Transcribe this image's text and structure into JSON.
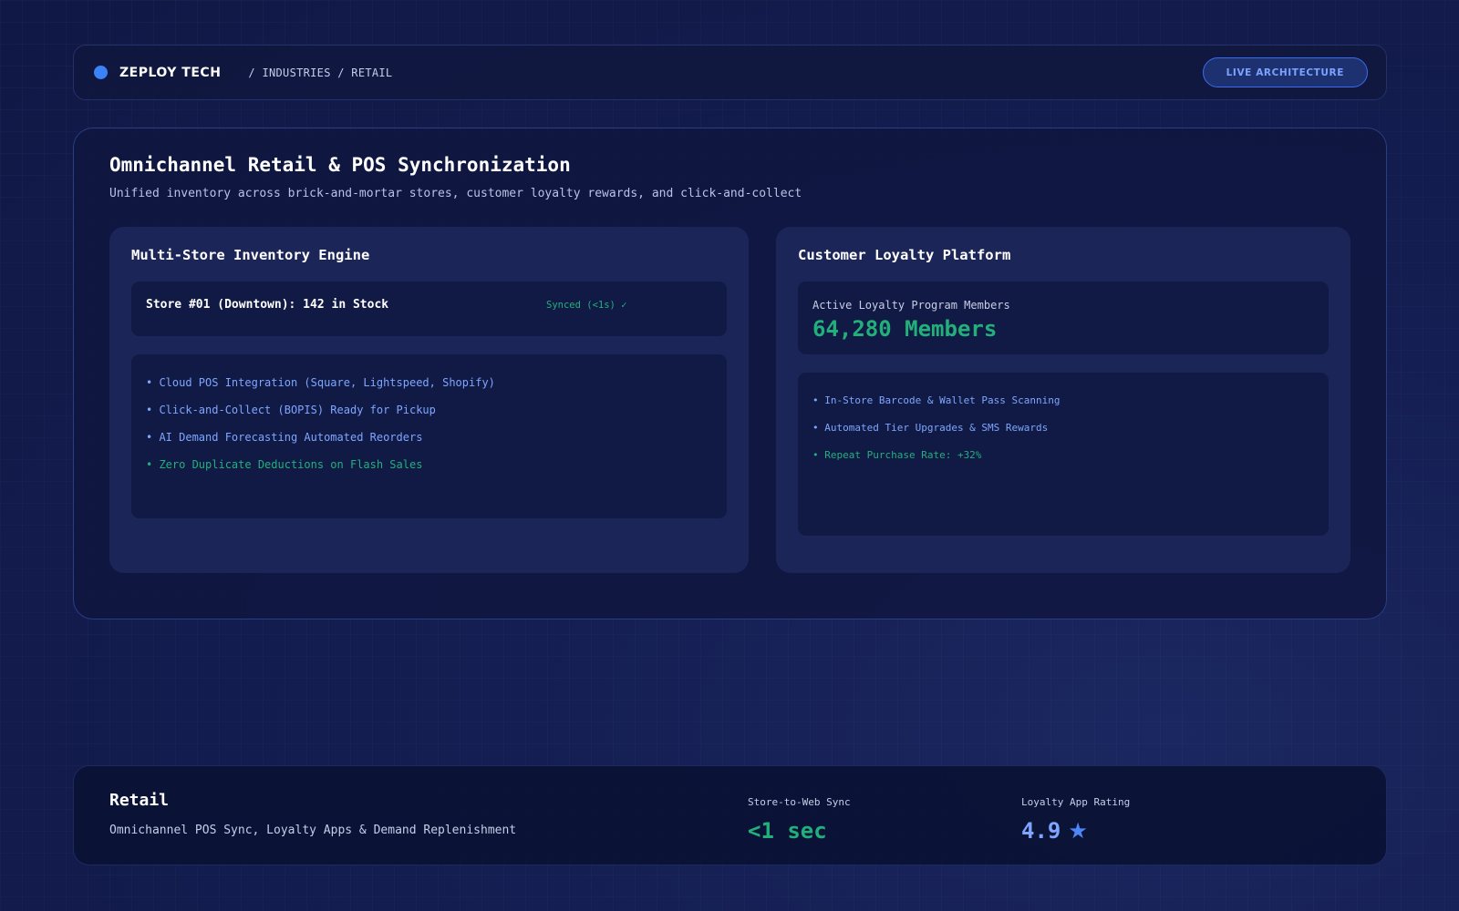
{
  "header": {
    "brand": "ZEPLOY TECH",
    "breadcrumb": "/ INDUSTRIES / RETAIL",
    "live_button": "LIVE ARCHITECTURE"
  },
  "main": {
    "title": "Omnichannel Retail & POS Synchronization",
    "subtitle": "Unified inventory across brick-and-mortar stores, customer loyalty rewards, and click-and-collect",
    "inventory": {
      "title": "Multi-Store Inventory Engine",
      "store_line": "Store #01 (Downtown): 142 in Stock",
      "sync_status": "Synced (<1s) ✓",
      "features": [
        "• Cloud POS Integration (Square, Lightspeed, Shopify)",
        "• Click-and-Collect (BOPIS) Ready for Pickup",
        "• AI Demand Forecasting Automated Reorders",
        "• Zero Duplicate Deductions on Flash Sales"
      ]
    },
    "loyalty": {
      "title": "Customer Loyalty Platform",
      "members_label": "Active Loyalty Program Members",
      "members_value": "64,280 Members",
      "features": [
        "• In-Store Barcode & Wallet Pass Scanning",
        "• Automated Tier Upgrades & SMS Rewards",
        "• Repeat Purchase Rate: +32%"
      ]
    }
  },
  "footer": {
    "title": "Retail",
    "subtitle": "Omnichannel POS Sync, Loyalty Apps & Demand Replenishment",
    "stats": [
      {
        "label": "Store-to-Web Sync",
        "value": "<1 sec"
      },
      {
        "label": "Loyalty App Rating",
        "value": "4.9",
        "icon": "star-icon"
      }
    ]
  },
  "colors": {
    "accent_blue": "#3b82f6",
    "success_green": "#22b07a",
    "link_blue": "#7ea6ff"
  }
}
